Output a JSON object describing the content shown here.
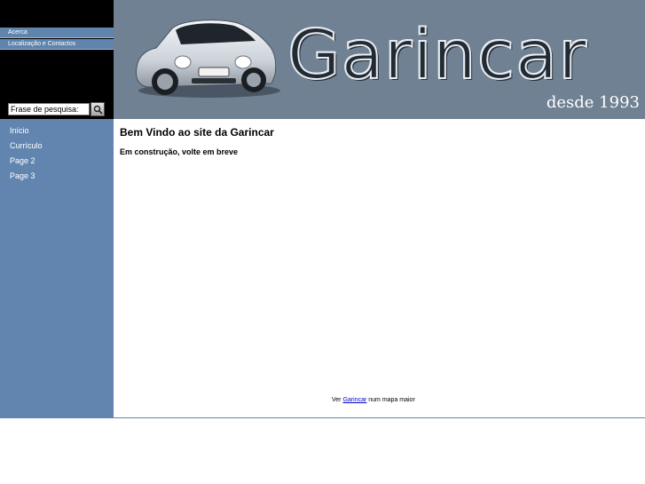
{
  "header": {
    "top_links": [
      "Acerca",
      "Localização e Contactos"
    ],
    "search": {
      "value": "Frase de pesquisa:",
      "button_icon": "search-icon"
    },
    "banner": {
      "logo_text": "Garincar",
      "tagline": "desde 1993",
      "car_icon": "car-icon"
    }
  },
  "sidebar": {
    "items": [
      "Início",
      "Currículo",
      "Page 2",
      "Page 3"
    ]
  },
  "main": {
    "title": "Bem Vindo ao site da Garincar",
    "notice": "Em construção, volte em breve",
    "map_caption": {
      "prefix": "Ver",
      "link": "Garincar",
      "suffix": "num mapa maior"
    }
  },
  "colors": {
    "sidebar_bg": "#6285b0",
    "banner_bg": "#6f8193",
    "header_black": "#000000",
    "link_blue": "#0000cc"
  }
}
